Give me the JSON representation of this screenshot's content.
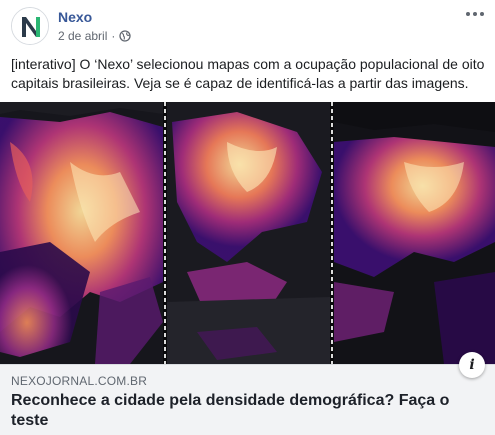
{
  "post": {
    "page_name": "Nexo",
    "date": "2 de abril",
    "separator": "·",
    "privacy_icon": "globe-icon",
    "more_icon": "more-horizontal-icon",
    "text": "[interativo] O ‘Nexo’ selecionou mapas com a ocupação populacional de oito capitais brasileiras. Veja se é capaz de identificá-las a partir das imagens."
  },
  "avatar": {
    "letter": "N",
    "colors": [
      "#2b3a4a",
      "#2bb673"
    ]
  },
  "link_preview": {
    "domain": "NEXOJORNAL.COM.BR",
    "headline": "Reconhece a cidade pela densidade demográfica? Faça o teste",
    "info_label": "i"
  },
  "colors": {
    "link_blue": "#385898",
    "heat_low": "#3b0f70",
    "heat_mid": "#b63679",
    "heat_high": "#fcdf9c"
  }
}
